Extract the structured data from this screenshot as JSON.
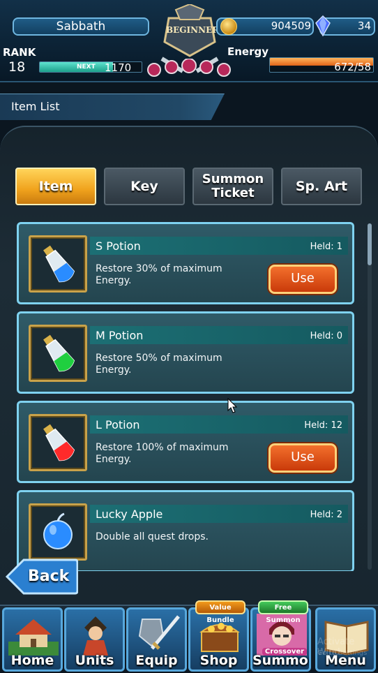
{
  "header": {
    "player_name": "Sabbath",
    "emblem_label": "BEGINNERS",
    "gil": "904509",
    "gems": "34",
    "rank_label": "RANK",
    "rank": "18",
    "next_label": "NEXT",
    "next_exp": "1170",
    "exp_progress": 0.72,
    "energy_label": "Energy",
    "energy": "672/58",
    "energy_progress": 1.0,
    "icons": {
      "gil": "gil-coin-icon",
      "gem": "lapis-crystal-icon"
    }
  },
  "title": "Item List",
  "tabs": [
    {
      "label": "Item",
      "active": true
    },
    {
      "label": "Key",
      "active": false
    },
    {
      "label_line1": "Summon",
      "label_line2": "Ticket",
      "active": false
    },
    {
      "label": "Sp. Art",
      "active": false
    }
  ],
  "items": [
    {
      "name": "S Potion",
      "held": "Held: 1",
      "desc": "Restore 30% of maximum Energy.",
      "use_label": "Use",
      "liquid": "#2a8cff",
      "icon": "s-potion-icon"
    },
    {
      "name": "M Potion",
      "held": "Held: 0",
      "desc": "Restore 50% of maximum Energy.",
      "icon": "m-potion-icon",
      "liquid": "#1fcf3f"
    },
    {
      "name": "L Potion",
      "held": "Held: 12",
      "desc": "Restore 100% of maximum Energy.",
      "use_label": "Use",
      "liquid": "#ff2a2a",
      "icon": "l-potion-icon"
    },
    {
      "name": "Lucky Apple",
      "held": "Held: 2",
      "desc": "Double all quest drops.",
      "icon": "lucky-apple-icon"
    }
  ],
  "back_label": "Back",
  "nav": [
    {
      "label": "Home",
      "icon": "house-icon"
    },
    {
      "label": "Units",
      "icon": "hero-icon"
    },
    {
      "label": "Equip",
      "icon": "sword-shield-icon"
    },
    {
      "label": "Shop",
      "icon": "treasure-chest-icon",
      "badge": "Value Bundle"
    },
    {
      "label": "Summon",
      "icon": "summon-portrait-icon",
      "badge": "Free Summon",
      "tag": "Crossover"
    },
    {
      "label": "Menu",
      "icon": "book-icon"
    }
  ],
  "watermark": {
    "line1": "Activate Wind",
    "line2": "Go to Settings"
  }
}
